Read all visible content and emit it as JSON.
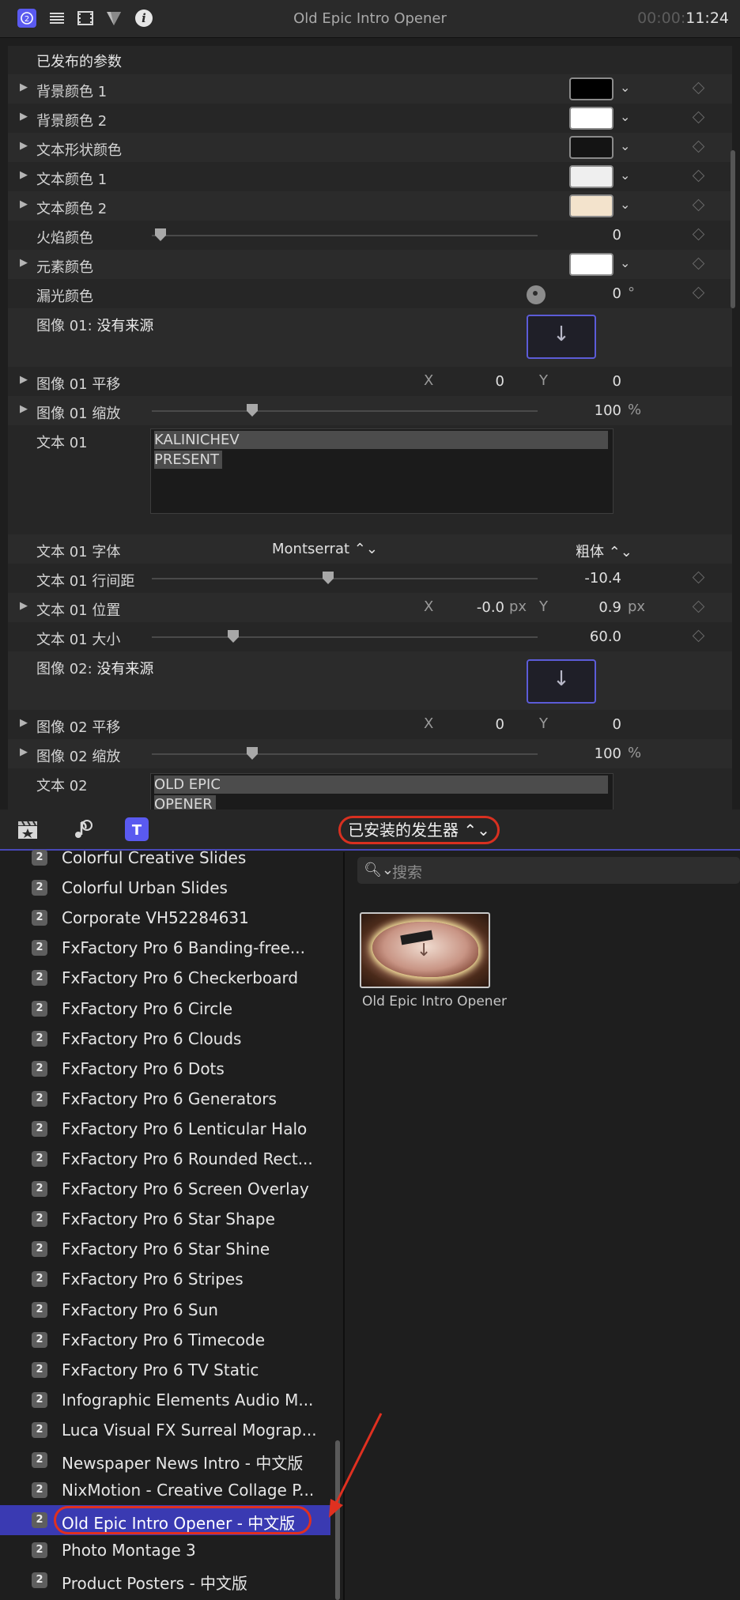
{
  "inspector": {
    "title": "Old Epic Intro Opener",
    "time_dim": "00:00:",
    "time": "11:24",
    "section": "已发布的参数",
    "rows": {
      "bg1": "背景颜色 1",
      "bg2": "背景颜色 2",
      "shape_color": "文本形状颜色",
      "text_color1": "文本颜色 1",
      "text_color2": "文本颜色 2",
      "flame_color": "火焰颜色",
      "flame_value": "0",
      "element_color": "元素颜色",
      "leak_color": "漏光颜色",
      "leak_value": "0",
      "leak_unit": "°",
      "image01_prefix": "图像 01:",
      "image01_source": "没有来源",
      "image01_pan": "图像 01 平移",
      "image01_pan_x": "0",
      "image01_pan_y": "0",
      "image01_scale": "图像 01 缩放",
      "image01_scale_value": "100",
      "image01_scale_unit": "%",
      "text01": "文本 01",
      "text01_line1": "KALINICHEV",
      "text01_line2": "PRESENT",
      "text01_font": "文本 01 字体",
      "text01_font_value": "Montserrat",
      "text01_weight_value": "粗体",
      "text01_spacing": "文本 01 行间距",
      "text01_spacing_value": "-10.4",
      "text01_position": "文本 01 位置",
      "text01_pos_x": "-0.0",
      "text01_pos_y": "0.9",
      "px": "px",
      "text01_size": "文本 01 大小",
      "text01_size_value": "60.0",
      "image02_prefix": "图像 02:",
      "image02_source": "没有来源",
      "image02_pan": "图像 02 平移",
      "image02_pan_x": "0",
      "image02_pan_y": "0",
      "image02_scale": "图像 02 缩放",
      "image02_scale_value": "100",
      "image02_scale_unit": "%",
      "text02": "文本 02",
      "text02_line1": "OLD EPIC",
      "text02_line2": "OPENER",
      "x": "X",
      "y": "Y"
    },
    "colors": {
      "bg1": "#000000",
      "bg2": "#ffffff",
      "shape": "#141414",
      "text1": "#efefef",
      "text2": "#f3e3cc",
      "element": "#ffffff"
    }
  },
  "browser": {
    "category_popup": "已安装的发生器 ⌃⌄",
    "search_placeholder": "搜索",
    "thumbnail_caption": "Old Epic Intro Opener",
    "items": [
      "Colorful Creative Slides",
      "Colorful Urban Slides",
      "Corporate VH52284631",
      "FxFactory Pro 6 Banding-free...",
      "FxFactory Pro 6 Checkerboard",
      "FxFactory Pro 6 Circle",
      "FxFactory Pro 6 Clouds",
      "FxFactory Pro 6 Dots",
      "FxFactory Pro 6 Generators",
      "FxFactory Pro 6 Lenticular Halo",
      "FxFactory Pro 6 Rounded Rect...",
      "FxFactory Pro 6 Screen Overlay",
      "FxFactory Pro 6 Star Shape",
      "FxFactory Pro 6 Star Shine",
      "FxFactory Pro 6 Stripes",
      "FxFactory Pro 6 Sun",
      "FxFactory Pro 6 Timecode",
      "FxFactory Pro 6 TV Static",
      "Infographic Elements Audio M...",
      "Luca Visual FX Surreal Mograp...",
      "Newspaper News Intro - 中文版",
      "NixMotion - Creative Collage P...",
      "Old Epic Intro Opener - 中文版",
      "Photo Montage 3",
      "Product Posters - 中文版"
    ],
    "selected_index": 22
  }
}
